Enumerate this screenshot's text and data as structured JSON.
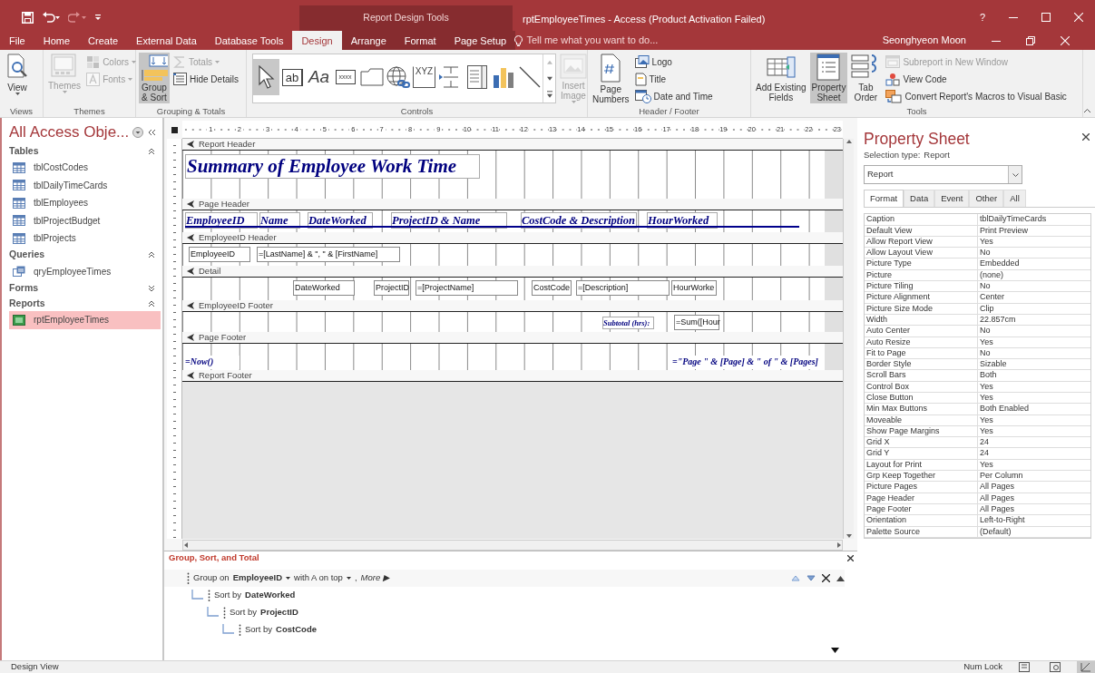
{
  "title_bar": {
    "context_title": "Report Design Tools",
    "title": "rptEmployeeTimes - Access (Product Activation Failed)",
    "help": "?"
  },
  "tabs": [
    {
      "label": "File",
      "selected": false,
      "context": false
    },
    {
      "label": "Home",
      "selected": false,
      "context": false
    },
    {
      "label": "Create",
      "selected": false,
      "context": false
    },
    {
      "label": "External Data",
      "selected": false,
      "context": false
    },
    {
      "label": "Database Tools",
      "selected": false,
      "context": false
    },
    {
      "label": "Design",
      "selected": true,
      "context": true
    },
    {
      "label": "Arrange",
      "selected": false,
      "context": true
    },
    {
      "label": "Format",
      "selected": false,
      "context": true
    },
    {
      "label": "Page Setup",
      "selected": false,
      "context": true
    }
  ],
  "tell_me": {
    "placeholder": "Tell me what you want to do..."
  },
  "user": "Seonghyeon Moon",
  "ribbon": [
    {
      "label": "Views",
      "buttons": [
        {
          "kind": "large",
          "lines": [
            "View"
          ],
          "disabled": false,
          "selected": false,
          "dropdown": true
        }
      ]
    },
    {
      "label": "Themes",
      "buttons": [
        {
          "kind": "large",
          "lines": [
            "Themes"
          ],
          "disabled": true,
          "selected": false,
          "dropdown": true
        },
        {
          "kind": "small",
          "label": "Colors",
          "disabled": true,
          "selected": false,
          "dropdown": true
        },
        {
          "kind": "small",
          "label": "Fonts",
          "disabled": true,
          "selected": false,
          "dropdown": true
        }
      ]
    },
    {
      "label": "Grouping & Totals",
      "buttons": [
        {
          "kind": "large",
          "lines": [
            "Group",
            "& Sort"
          ],
          "disabled": false,
          "selected": true,
          "dropdown": false
        },
        {
          "kind": "small",
          "label": "Totals",
          "disabled": true,
          "selected": false,
          "dropdown": true
        },
        {
          "kind": "small",
          "label": "Hide Details",
          "disabled": false,
          "selected": false,
          "dropdown": false
        }
      ]
    },
    {
      "label": "Controls",
      "gallery": [
        {
          "kind": "pointer",
          "selected": true
        },
        {
          "kind": "textbox",
          "glyph": "ab",
          "selected": false
        },
        {
          "kind": "label",
          "glyph": "Aa",
          "selected": false
        },
        {
          "kind": "button",
          "glyph": "xxxx",
          "selected": false
        },
        {
          "kind": "tab",
          "selected": false
        },
        {
          "kind": "hyperlink",
          "selected": false
        },
        {
          "kind": "option_group",
          "glyph": "XYZ",
          "selected": false
        },
        {
          "kind": "page_break",
          "selected": false
        },
        {
          "kind": "list",
          "selected": false
        },
        {
          "kind": "chart",
          "selected": false
        },
        {
          "kind": "line",
          "selected": false
        }
      ],
      "buttons": [
        {
          "kind": "large",
          "lines": [
            "Insert",
            "Image"
          ],
          "disabled": true,
          "selected": false,
          "dropdown": true
        }
      ]
    },
    {
      "label": "Header / Footer",
      "buttons": [
        {
          "kind": "large",
          "lines": [
            "Page",
            "Numbers"
          ],
          "disabled": false,
          "selected": false,
          "dropdown": false
        },
        {
          "kind": "small",
          "label": "Logo",
          "disabled": false,
          "selected": false,
          "dropdown": false
        },
        {
          "kind": "small",
          "label": "Title",
          "disabled": false,
          "selected": false,
          "dropdown": false
        },
        {
          "kind": "small",
          "label": "Date and Time",
          "disabled": false,
          "selected": false,
          "dropdown": false
        }
      ]
    },
    {
      "label": "Tools",
      "buttons": [
        {
          "kind": "large",
          "lines": [
            "Add Existing",
            "Fields"
          ],
          "disabled": false,
          "selected": false,
          "dropdown": false
        },
        {
          "kind": "large",
          "lines": [
            "Property",
            "Sheet"
          ],
          "disabled": false,
          "selected": true,
          "dropdown": false
        },
        {
          "kind": "large",
          "lines": [
            "Tab",
            "Order"
          ],
          "disabled": false,
          "selected": false,
          "dropdown": false
        },
        {
          "kind": "small",
          "label": "Subreport in New Window",
          "disabled": true,
          "selected": false,
          "dropdown": false
        },
        {
          "kind": "small",
          "label": "View Code",
          "disabled": false,
          "selected": false,
          "dropdown": false
        },
        {
          "kind": "small",
          "label": "Convert Report's Macros to Visual Basic",
          "disabled": false,
          "selected": false,
          "dropdown": false
        }
      ]
    }
  ],
  "nav": {
    "title": "All Access Obje...",
    "groups": [
      {
        "kind": "tables",
        "label": "Tables",
        "expanded": true,
        "items": [
          {
            "label": "tblCostCodes",
            "selected": false
          },
          {
            "label": "tblDailyTimeCards",
            "selected": false
          },
          {
            "label": "tblEmployees",
            "selected": false
          },
          {
            "label": "tblProjectBudget",
            "selected": false
          },
          {
            "label": "tblProjects",
            "selected": false
          }
        ]
      },
      {
        "kind": "queries",
        "label": "Queries",
        "expanded": true,
        "items": [
          {
            "label": "qryEmployeeTimes",
            "selected": false
          }
        ]
      },
      {
        "label": "Forms",
        "expanded": false
      },
      {
        "kind": "reports",
        "label": "Reports",
        "expanded": true,
        "items": [
          {
            "label": "rptEmployeeTimes",
            "selected": true
          }
        ]
      }
    ]
  },
  "design": {
    "ruler_marks": [
      "1",
      "2",
      "3",
      "4",
      "5",
      "6",
      "7",
      "8",
      "9",
      "10",
      "11",
      "12",
      "13",
      "14",
      "15",
      "16",
      "17",
      "18",
      "19",
      "20",
      "21",
      "22",
      "23"
    ],
    "sections": [
      {
        "title": "Report Header",
        "controls": [
          {
            "kind": "title",
            "text": "Summary of Employee Work Time"
          }
        ]
      },
      {
        "title": "Page Header",
        "controls": [
          {
            "kind": "label",
            "text": "EmployeeID"
          },
          {
            "kind": "label",
            "text": "Name"
          },
          {
            "kind": "label",
            "text": "DateWorked"
          },
          {
            "kind": "label",
            "text": "ProjectID & Name"
          },
          {
            "kind": "label",
            "text": "CostCode & Description"
          },
          {
            "kind": "label",
            "text": "HourWorked"
          },
          {
            "kind": "line"
          }
        ]
      },
      {
        "title": "EmployeeID Header",
        "controls": [
          {
            "kind": "textbox",
            "text": "EmployeeID"
          },
          {
            "kind": "textbox",
            "text": "=[LastName] & \", \" & [FirstName]"
          }
        ]
      },
      {
        "title": "Detail",
        "controls": [
          {
            "kind": "textbox",
            "text": "DateWorked"
          },
          {
            "kind": "textbox",
            "text": "ProjectID"
          },
          {
            "kind": "textbox",
            "text": "=[ProjectName]"
          },
          {
            "kind": "textbox",
            "text": "CostCode"
          },
          {
            "kind": "textbox",
            "text": "=[Description]"
          },
          {
            "kind": "textbox",
            "text": "HourWorke"
          }
        ]
      },
      {
        "title": "EmployeeID Footer",
        "controls": [
          {
            "kind": "small_label",
            "text": "Subtotal (hrs):"
          },
          {
            "kind": "textbox",
            "text": "=Sum([Hour"
          }
        ]
      },
      {
        "title": "Page Footer",
        "controls": [
          {
            "kind": "expression",
            "text": "=Now()"
          },
          {
            "kind": "expression",
            "text": "=\"Page \" & [Page] & \" of \" & [Pages]"
          }
        ]
      },
      {
        "title": "Report Footer"
      }
    ]
  },
  "group_panel": {
    "title": "Group, Sort, and Total",
    "levels": [
      {
        "kind": "group",
        "prefix": "Group on",
        "field": "EmployeeID",
        "order": "with A on top",
        "separator": ",",
        "more": "More ▶",
        "children": [
          {
            "kind": "sort",
            "prefix": "Sort by",
            "field": "DateWorked",
            "children": [
              {
                "kind": "sort",
                "prefix": "Sort by",
                "field": "ProjectID",
                "children": [
                  {
                    "kind": "sort",
                    "prefix": "Sort by",
                    "field": "CostCode"
                  }
                ]
              }
            ]
          }
        ]
      }
    ]
  },
  "property_sheet": {
    "title": "Property Sheet",
    "selection_label": "Selection type:",
    "selection_type": "Report",
    "selector": "Report",
    "tabs": [
      {
        "label": "Format",
        "selected": true
      },
      {
        "label": "Data",
        "selected": false
      },
      {
        "label": "Event",
        "selected": false
      },
      {
        "label": "Other",
        "selected": false
      },
      {
        "label": "All",
        "selected": false
      }
    ],
    "rows": [
      {
        "name": "Caption",
        "value": "tblDailyTimeCards"
      },
      {
        "name": "Default View",
        "value": "Print Preview"
      },
      {
        "name": "Allow Report View",
        "value": "Yes"
      },
      {
        "name": "Allow Layout View",
        "value": "No"
      },
      {
        "name": "Picture Type",
        "value": "Embedded"
      },
      {
        "name": "Picture",
        "value": "(none)"
      },
      {
        "name": "Picture Tiling",
        "value": "No"
      },
      {
        "name": "Picture Alignment",
        "value": "Center"
      },
      {
        "name": "Picture Size Mode",
        "value": "Clip"
      },
      {
        "name": "Width",
        "value": "22.857cm"
      },
      {
        "name": "Auto Center",
        "value": "No"
      },
      {
        "name": "Auto Resize",
        "value": "Yes"
      },
      {
        "name": "Fit to Page",
        "value": "No"
      },
      {
        "name": "Border Style",
        "value": "Sizable"
      },
      {
        "name": "Scroll Bars",
        "value": "Both"
      },
      {
        "name": "Control Box",
        "value": "Yes"
      },
      {
        "name": "Close Button",
        "value": "Yes"
      },
      {
        "name": "Min Max Buttons",
        "value": "Both Enabled"
      },
      {
        "name": "Moveable",
        "value": "Yes"
      },
      {
        "name": "Show Page Margins",
        "value": "Yes"
      },
      {
        "name": "Grid X",
        "value": "24"
      },
      {
        "name": "Grid Y",
        "value": "24"
      },
      {
        "name": "Layout for Print",
        "value": "Yes"
      },
      {
        "name": "Grp Keep Together",
        "value": "Per Column"
      },
      {
        "name": "Picture Pages",
        "value": "All Pages"
      },
      {
        "name": "Page Header",
        "value": "All Pages"
      },
      {
        "name": "Page Footer",
        "value": "All Pages"
      },
      {
        "name": "Orientation",
        "value": "Left-to-Right"
      },
      {
        "name": "Palette Source",
        "value": "(Default)"
      }
    ]
  },
  "status_bar": {
    "mode": "Design View",
    "indicators": [
      "Num Lock"
    ],
    "views": [
      {
        "selected": false
      },
      {
        "selected": false
      },
      {
        "selected": true
      }
    ]
  }
}
